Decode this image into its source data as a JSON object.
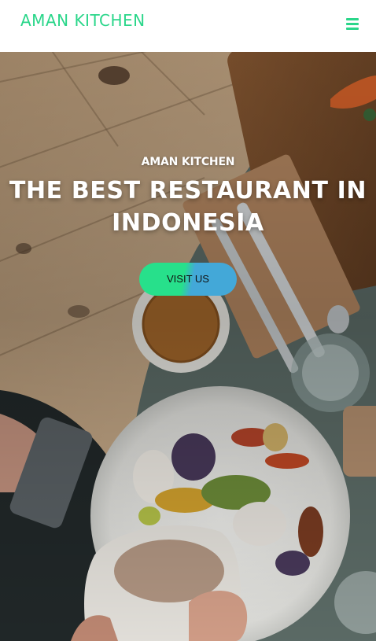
{
  "navbar": {
    "brand": "AMAN KITCHEN",
    "menu_icon": "hamburger-menu-icon",
    "accent_color": "#2ad68a"
  },
  "hero": {
    "eyebrow": "AMAN KITCHEN",
    "headline": "THE BEST RESTAURANT IN INDONESIA",
    "cta_label": "VISIT US",
    "cta_gradient": [
      "#27e08b",
      "#43a8d8"
    ],
    "background": "food-table-photo"
  }
}
